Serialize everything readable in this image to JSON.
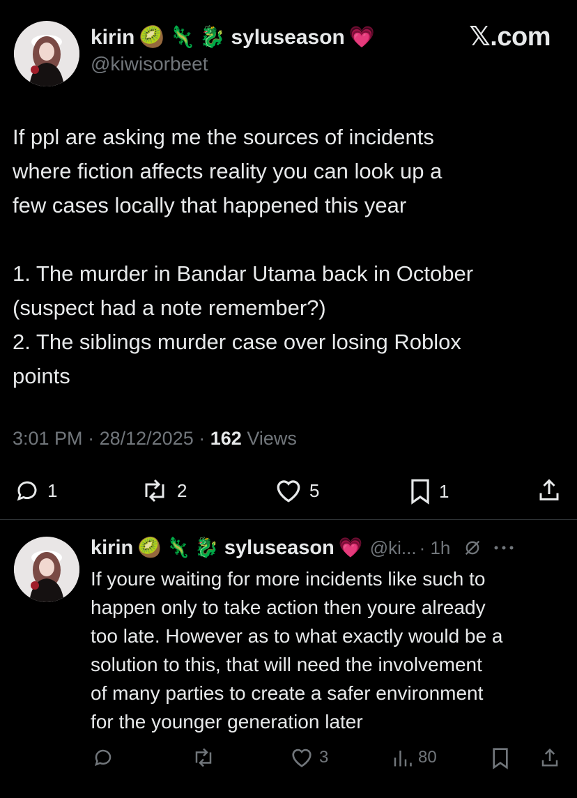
{
  "brand": "𝕏.com",
  "post": {
    "name": "kirin",
    "emojis": [
      "🥝",
      "🦎",
      "🐉"
    ],
    "name_suffix": "syluseason",
    "heart": "💗",
    "handle": "@kiwisorbeet",
    "text_lines": [
      "If ppl are asking me the sources of incidents",
      "where fiction affects reality you can look up a",
      "few cases locally that happened this year",
      "",
      "1. The murder in Bandar Utama back in October",
      "(suspect had a note remember?)",
      "2. The siblings murder case over losing Roblox",
      "points"
    ],
    "time": "3:01 PM",
    "date": "28/12/2025",
    "views_count": "162",
    "views_label": "Views",
    "actions": {
      "replies": "1",
      "reposts": "2",
      "likes": "5",
      "bookmarks": "1"
    }
  },
  "reply": {
    "name": "kirin",
    "emojis": [
      "🥝",
      "🦎",
      "🐉"
    ],
    "name_suffix": "syluseason",
    "heart": "💗",
    "handle": "@ki...",
    "time": "· 1h",
    "text_lines": [
      "If youre waiting for more incidents like such to",
      "happen only to take action then youre already",
      "too late. However as to what exactly would be a",
      "solution to this, that will need the involvement",
      "of many parties to create a safer environment",
      "for the younger generation later"
    ],
    "actions": {
      "likes": "3",
      "views": "80"
    }
  },
  "colors": {
    "background": "#000000",
    "text": "#e7e9ea",
    "muted": "#71767b",
    "divider": "#2f3336"
  }
}
